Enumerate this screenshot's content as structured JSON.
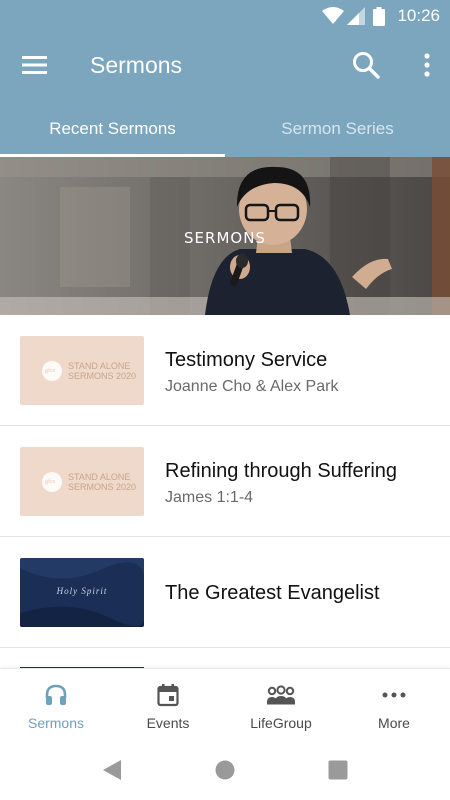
{
  "status_bar": {
    "time": "10:26"
  },
  "app_bar": {
    "title": "Sermons"
  },
  "tabs": [
    {
      "label": "Recent Sermons",
      "active": true
    },
    {
      "label": "Sermon Series",
      "active": false
    }
  ],
  "hero": {
    "label": "SERMONS"
  },
  "sermons": [
    {
      "title": "Testimony Service",
      "subtitle": "Joanne Cho & Alex Park",
      "thumb_line1": "STAND ALONE",
      "thumb_line2": "SERMONS 2020",
      "thumb_logo": "gfce"
    },
    {
      "title": "Refining through Suffering",
      "subtitle": "James 1:1-4",
      "thumb_line1": "STAND ALONE",
      "thumb_line2": "SERMONS 2020",
      "thumb_logo": "gfce"
    },
    {
      "title": "The Greatest Evangelist",
      "subtitle": "",
      "thumb_text": "Holy Spirit"
    }
  ],
  "bottom_nav": [
    {
      "label": "Sermons",
      "icon": "headphones-icon",
      "active": true
    },
    {
      "label": "Events",
      "icon": "calendar-icon",
      "active": false
    },
    {
      "label": "LifeGroup",
      "icon": "group-icon",
      "active": false
    },
    {
      "label": "More",
      "icon": "more-horizontal-icon",
      "active": false
    }
  ],
  "colors": {
    "primary": "#7ba6be",
    "active_nav": "#6fa1bd",
    "thumb_beige": "#efd9ca",
    "thumb_navy": "#1b2e55"
  }
}
